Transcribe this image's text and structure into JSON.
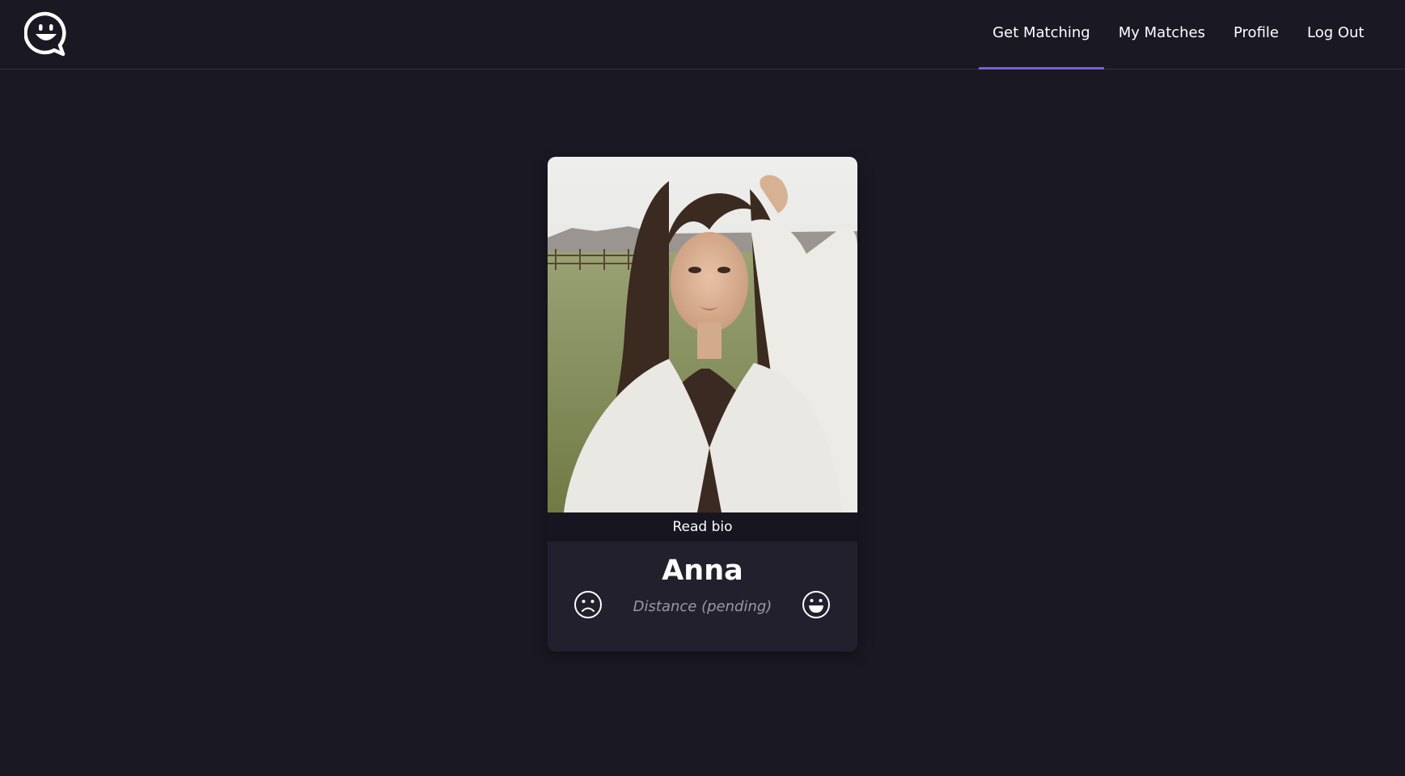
{
  "nav": {
    "items": [
      {
        "label": "Get Matching",
        "active": true
      },
      {
        "label": "My Matches",
        "active": false
      },
      {
        "label": "Profile",
        "active": false
      },
      {
        "label": "Log Out",
        "active": false
      }
    ]
  },
  "card": {
    "read_bio_label": "Read bio",
    "name": "Anna",
    "distance": "Distance (pending)"
  },
  "colors": {
    "background": "#1a1823",
    "accent": "#7b5fd9",
    "card": "#23202e"
  }
}
